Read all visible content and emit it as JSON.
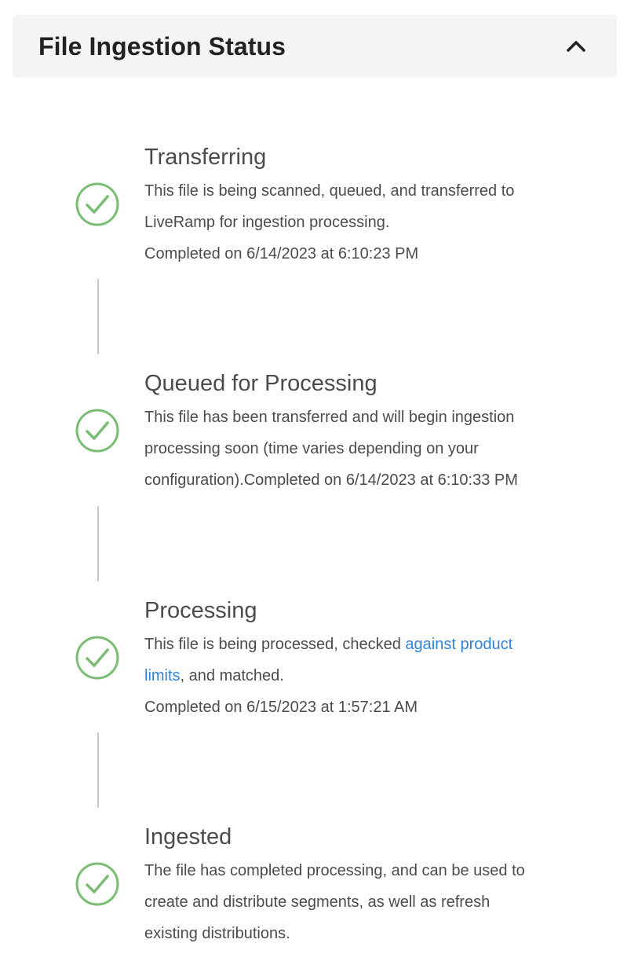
{
  "panel": {
    "title": "File Ingestion Status",
    "collapse_icon": "chevron-up-icon"
  },
  "colors": {
    "success": "#79bd72",
    "link": "#2f82d8",
    "text": "#4b4b4b",
    "connector": "#c8c8c8",
    "header_bg": "#f4f4f4"
  },
  "steps": [
    {
      "title": "Transferring",
      "status_icon": "check-circle-icon",
      "line1": "This file is being scanned, queued, and transferred to",
      "line2": "LiveRamp for ingestion processing.",
      "line3": "Completed on 6/14/2023 at 6:10:23 PM"
    },
    {
      "title": "Queued for Processing",
      "status_icon": "check-circle-icon",
      "line1": "This file has been transferred and will begin ingestion",
      "line2": "processing soon (time varies depending on your",
      "line3": "configuration).Completed on 6/14/2023 at 6:10:33 PM"
    },
    {
      "title": "Processing",
      "status_icon": "check-circle-icon",
      "line1_text": "This file is being processed, checked ",
      "line1_link": "against product",
      "line2_link": "limits",
      "line2_text": ", and matched.",
      "line3": "Completed on 6/15/2023 at 1:57:21 AM"
    },
    {
      "title": "Ingested",
      "status_icon": "check-circle-icon",
      "line1": "The file has completed processing, and can be used to",
      "line2": "create and distribute segments, as well as refresh",
      "line3": "existing distributions."
    }
  ]
}
